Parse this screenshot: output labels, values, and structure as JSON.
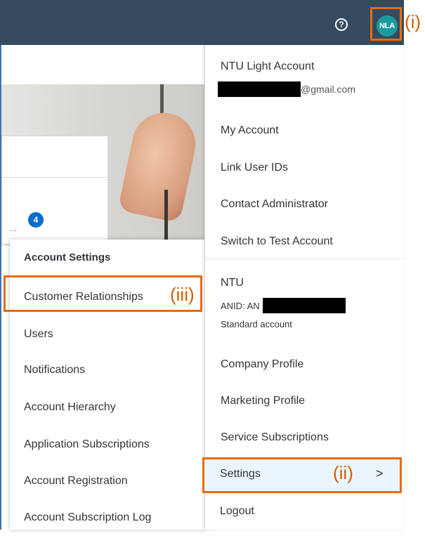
{
  "header": {
    "help_icon": "help-icon",
    "help_glyph": "?",
    "avatar_initials": "NLA",
    "callout_i": "(i)"
  },
  "badge": {
    "count": "4",
    "dots": "..."
  },
  "user_menu": {
    "account_name": "NTU Light Account",
    "email_suffix": "@gmail.com",
    "items_top": [
      "My Account",
      "Link User IDs",
      "Contact Administrator",
      "Switch to Test Account"
    ],
    "org_name": "NTU",
    "anid_prefix": "ANID: AN",
    "account_type": "Standard account",
    "items_org": [
      "Company Profile",
      "Marketing Profile",
      "Service Subscriptions"
    ],
    "settings_label": "Settings",
    "callout_ii": "(ii)",
    "settings_chevron": ">",
    "logout_label": "Logout"
  },
  "account_settings_menu": {
    "title": "Account Settings",
    "items": [
      "Customer Relationships",
      "Users",
      "Notifications",
      "Account Hierarchy",
      "Application Subscriptions",
      "Account Registration",
      "Account Subscription Log"
    ],
    "callout_iii": "(iii)"
  },
  "colors": {
    "header_bg": "#354a5f",
    "highlight_orange": "#e66d0d",
    "avatar_bg": "#1a9ba0",
    "badge_bg": "#0a6ed1",
    "selected_row_bg": "#ebf5fe"
  }
}
